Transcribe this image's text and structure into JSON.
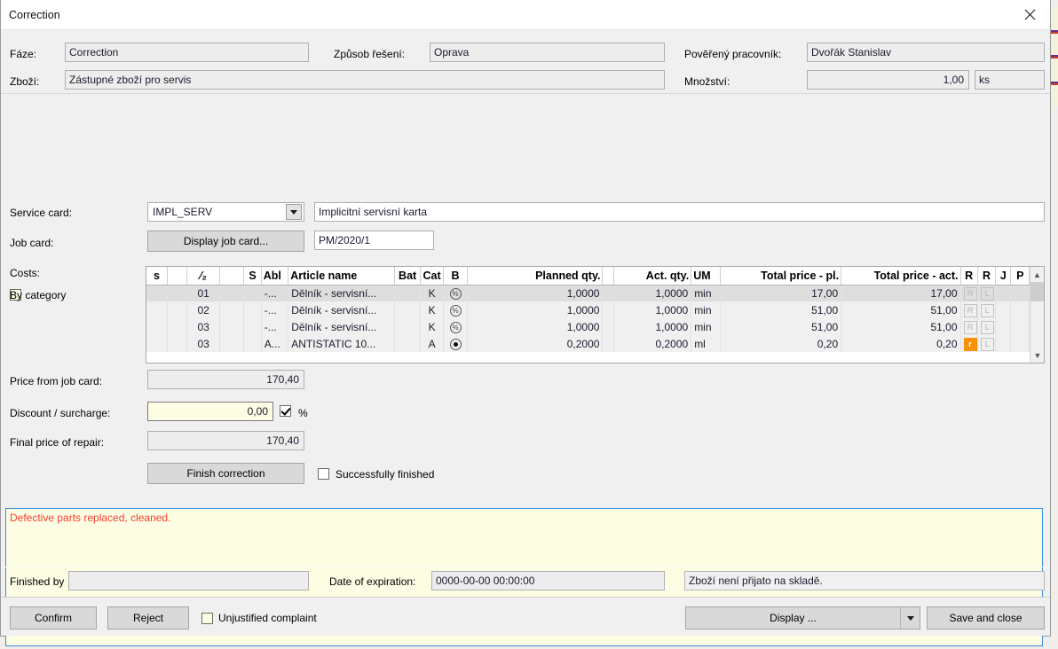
{
  "window": {
    "title": "Correction",
    "close_icon": "close-icon"
  },
  "header": {
    "phase_label": "Fáze:",
    "phase_value": "Correction",
    "solution_label": "Způsob řešení:",
    "solution_value": "Oprava",
    "worker_label": "Pověřený pracovník:",
    "worker_value": "Dvořák Stanislav",
    "goods_label": "Zboží:",
    "goods_value": "Zástupné zboží pro servis",
    "quantity_label": "Množství:",
    "quantity_value": "1,00",
    "unit_value": "ks"
  },
  "service": {
    "service_card_label": "Service card:",
    "service_card_value": "IMPL_SERV",
    "service_card_desc": "Implicitní servisní karta",
    "dropdown_icon": "chevron-down-icon",
    "job_card_label": "Job card:",
    "job_card_button": "Display job card...",
    "job_card_value": "PM/2020/1"
  },
  "costs": {
    "label": "Costs:",
    "by_category_label": "By category",
    "by_category_checked": false,
    "columns": [
      "s",
      "",
      "⁄₂",
      "",
      "S",
      "Abl",
      "Article name",
      "Bat",
      "Cat",
      "B",
      "Planned qty.",
      "",
      "Act. qty.",
      "UM",
      "Total price - pl.",
      "Total price - act.",
      "R",
      "R",
      "J",
      "P"
    ],
    "rows": [
      {
        "s": "",
        "blank1": "",
        "num": "01",
        "blank2": "",
        "s2": "",
        "abl": "-...",
        "article": "Dělník - servisní...",
        "bat": "",
        "cat": "K",
        "b_icon": "percent-circle-icon",
        "planned": "1,0000",
        "pad": "",
        "actual": "1,0000",
        "um": "min",
        "total_pl": "17,00",
        "total_act": "17,00",
        "r1": "R",
        "r1_on": false,
        "r2": "L",
        "r2_on": false,
        "j": "",
        "p": ""
      },
      {
        "s": "",
        "blank1": "",
        "num": "02",
        "blank2": "",
        "s2": "",
        "abl": "-...",
        "article": "Dělník - servisní...",
        "bat": "",
        "cat": "K",
        "b_icon": "percent-circle-icon",
        "planned": "1,0000",
        "pad": "",
        "actual": "1,0000",
        "um": "min",
        "total_pl": "51,00",
        "total_act": "51,00",
        "r1": "R",
        "r1_on": false,
        "r2": "L",
        "r2_on": false,
        "j": "",
        "p": ""
      },
      {
        "s": "",
        "blank1": "",
        "num": "03",
        "blank2": "",
        "s2": "",
        "abl": "-...",
        "article": "Dělník - servisní...",
        "bat": "",
        "cat": "K",
        "b_icon": "percent-circle-icon",
        "planned": "1,0000",
        "pad": "",
        "actual": "1,0000",
        "um": "min",
        "total_pl": "51,00",
        "total_act": "51,00",
        "r1": "R",
        "r1_on": false,
        "r2": "L",
        "r2_on": false,
        "j": "",
        "p": ""
      },
      {
        "s": "",
        "blank1": "",
        "num": "03",
        "blank2": "",
        "s2": "",
        "abl": "A...",
        "article": "ANTISTATIC 10...",
        "bat": "",
        "cat": "A",
        "b_icon": "radio-dot-icon",
        "planned": "0,2000",
        "pad": "",
        "actual": "0,2000",
        "um": "ml",
        "total_pl": "0,20",
        "total_act": "0,20",
        "r1": "r",
        "r1_on": true,
        "r2": "L",
        "r2_on": false,
        "j": "",
        "p": ""
      }
    ],
    "scroll_up_icon": "chevron-up-icon",
    "scroll_down_icon": "chevron-down-icon"
  },
  "pricing": {
    "price_from_job_card_label": "Price from job card:",
    "price_from_job_card_value": "170,40",
    "discount_label": "Discount / surcharge:",
    "discount_value": "0,00",
    "percent_checked": true,
    "percent_label": "%",
    "final_price_label": "Final price of repair:",
    "final_price_value": "170,40",
    "finish_correction_button": "Finish correction",
    "successfully_finished_label": "Successfully finished",
    "successfully_finished_checked": false
  },
  "note": {
    "value": "Defective parts replaced, cleaned.",
    "text_color": "#f8402f",
    "bg_color": "#fdfde4",
    "border_color": "#3c8ddb"
  },
  "bottom_info": {
    "finished_by_label": "Finished by",
    "finished_by_value": "",
    "expiration_label": "Date of expiration:",
    "expiration_value": "0000-00-00 00:00:00",
    "stock_status": "Zboží není přijato na skladě."
  },
  "actions": {
    "confirm": "Confirm",
    "reject": "Reject",
    "unjustified_label": "Unjustified complaint",
    "unjustified_checked": false,
    "display_button": "Display ...",
    "display_arrow_icon": "chevron-down-icon",
    "save_and_close": "Save and close"
  },
  "colors": {
    "accent_orange": "#fb9007",
    "focus_blue": "#3c8ddb",
    "note_yellow": "#fdfde4"
  }
}
